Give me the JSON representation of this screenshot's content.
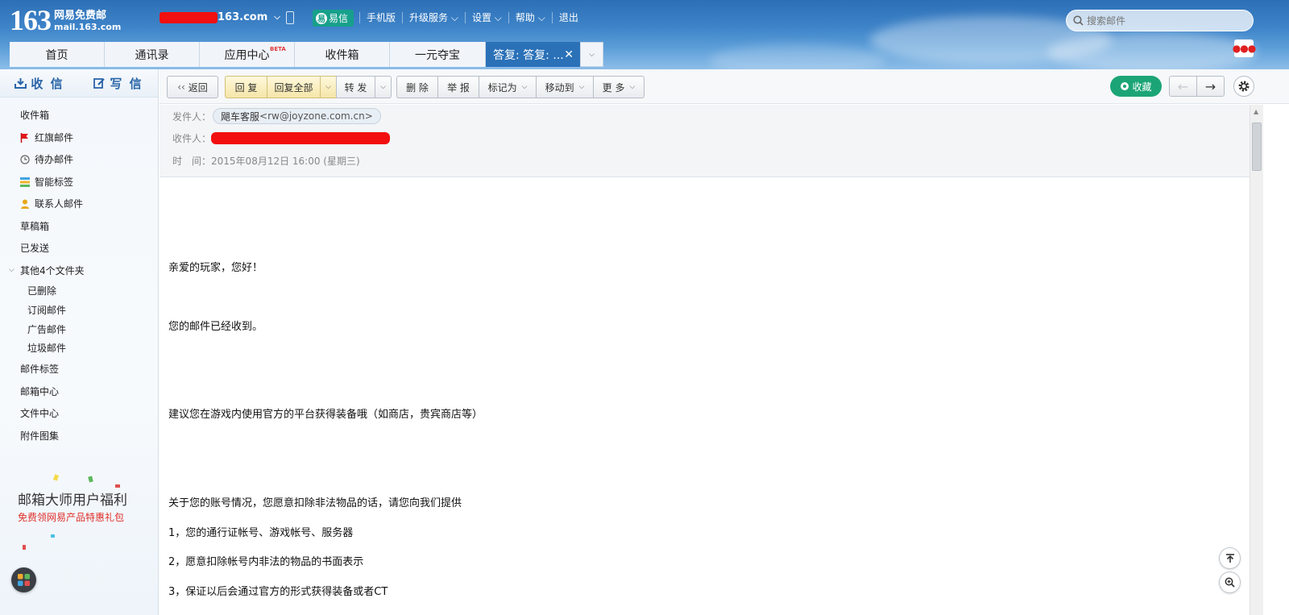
{
  "header": {
    "logo_number": "163",
    "logo_name": "网易免费邮",
    "logo_url": "mail.163.com",
    "account_suffix": "163.com",
    "yixin_label": "易信",
    "nav": [
      "手机版",
      "升级服务",
      "设置",
      "帮助",
      "退出"
    ],
    "search_placeholder": "搜索邮件"
  },
  "tabs": [
    {
      "label": "首页"
    },
    {
      "label": "通讯录"
    },
    {
      "label": "应用中心",
      "badge": "BETA"
    },
    {
      "label": "收件箱"
    },
    {
      "label": "一元夺宝"
    },
    {
      "label": "答复: 答复: ..."
    }
  ],
  "sidebar": {
    "receive": "收 信",
    "compose": "写 信",
    "items": [
      "收件箱",
      "红旗邮件",
      "待办邮件",
      "智能标签",
      "联系人邮件",
      "草稿箱",
      "已发送",
      "其他4个文件夹"
    ],
    "subfolders": [
      "已删除",
      "订阅邮件",
      "广告邮件",
      "垃圾邮件"
    ],
    "bottom_items": [
      "邮件标签",
      "邮箱中心",
      "文件中心",
      "附件图集"
    ],
    "promo_title": "邮箱大师用户福利",
    "promo_sub": "免费领网易产品特惠礼包"
  },
  "toolbar": {
    "back": "返回",
    "reply": "回 复",
    "reply_all": "回复全部",
    "forward": "转 发",
    "delete": "删 除",
    "report": "举 报",
    "mark_as": "标记为",
    "move_to": "移动到",
    "more": "更 多",
    "favorite": "收藏"
  },
  "mail": {
    "from_label": "发件人：",
    "from_name": "飓车客服",
    "from_addr": "<rw@joyzone.com.cn>",
    "to_label": "收件人：",
    "time_label": "时　间：",
    "time_value": "2015年08月12日 16:00 (星期三)",
    "body": [
      "亲爱的玩家，您好！",
      "您的邮件已经收到。",
      "建议您在游戏内使用官方的平台获得装备哦（如商店，贵宾商店等）",
      "关于您的账号情况，您愿意扣除非法物品的话，请您向我们提供",
      "1，您的通行证帐号、游戏帐号、服务器",
      "2，愿意扣除帐号内非法的物品的书面表示",
      "3，保证以后会通过官方的形式获得装备或者CT"
    ]
  },
  "colors": {
    "header_blue": "#2d6fb6",
    "active_tab": "#2a71b8",
    "yixin_green": "#17a08b",
    "favorite_green": "#1ba576",
    "redaction_red": "#f20f0f"
  }
}
